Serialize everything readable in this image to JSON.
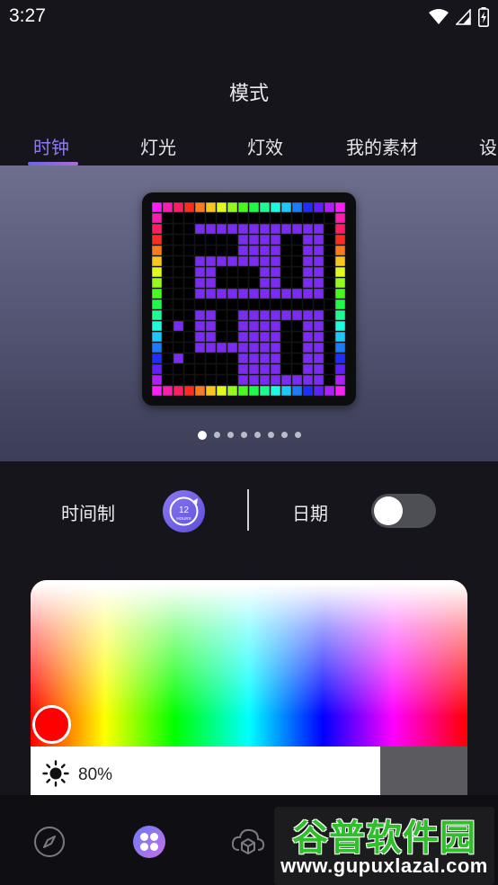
{
  "status_bar": {
    "time": "3:27",
    "icons": [
      "wifi-icon",
      "signal-icon",
      "battery-charging-icon"
    ]
  },
  "header": {
    "title": "模式"
  },
  "tabs": [
    {
      "label": "时钟",
      "active": true
    },
    {
      "label": "灯光",
      "active": false
    },
    {
      "label": "灯效",
      "active": false
    },
    {
      "label": "我的素材",
      "active": false
    },
    {
      "label": "设",
      "active": false
    }
  ],
  "preview": {
    "clock_text": "20:40",
    "page_count": 8,
    "current_page": 1
  },
  "settings": {
    "time_format_label": "时间制",
    "time_format_badge": "12",
    "time_format_sub": "HOURS",
    "date_label": "日期",
    "date_enabled": false
  },
  "color_picker": {
    "selected_color": "#ff0000",
    "brightness_value": "80%",
    "brightness_fraction": 0.8
  },
  "bottom_nav": [
    {
      "icon": "compass-icon",
      "active": false
    },
    {
      "icon": "grid-petals-icon",
      "active": true
    },
    {
      "icon": "cloud-cube-icon",
      "active": false
    }
  ],
  "watermark": {
    "title": "谷普软件园",
    "url": "www.gupuxlazal.com"
  },
  "colors": {
    "accent": "#8c7cf2",
    "background": "#16151c",
    "digit_purple": "#7a2df0"
  }
}
